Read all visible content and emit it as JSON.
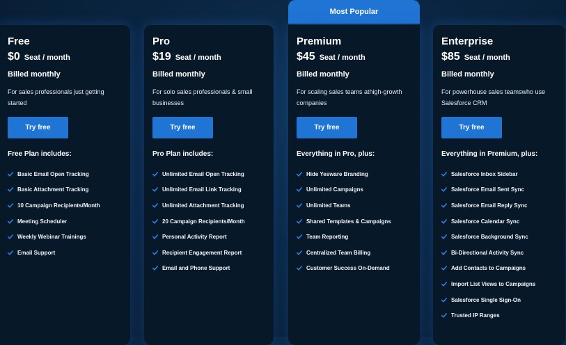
{
  "colors": {
    "accent": "#1f74d4",
    "card_bg": "#071829",
    "page_bg": "#0a2440",
    "check": "#2d7fdc"
  },
  "banner": {
    "label": "Most Popular"
  },
  "plans": [
    {
      "name": "Free",
      "price": "$0",
      "unit": "Seat / month",
      "billing": "Billed monthly",
      "description": "For sales professionals just getting started",
      "cta": "Try free",
      "includes_title": "Free Plan includes:",
      "features": [
        "Basic Email Open Tracking",
        "Basic Attachment Tracking",
        "10 Campaign Recipients/Month",
        "Meeting Scheduler",
        "Weekly Webinar Trainings",
        "Email Support"
      ]
    },
    {
      "name": "Pro",
      "price": "$19",
      "unit": "Seat / month",
      "billing": "Billed monthly",
      "description": "For solo sales professionals & small businesses",
      "cta": "Try free",
      "includes_title": "Pro Plan includes:",
      "features": [
        "Unlimited Email Open Tracking",
        "Unlimited Email Link Tracking",
        "Unlimited Attachment Tracking",
        "20 Campaign Recipients/Month",
        "Personal Activity Report",
        "Recipient Engagement Report",
        "Email and Phone Support"
      ]
    },
    {
      "name": "Premium",
      "price": "$45",
      "unit": "Seat / month",
      "billing": "Billed monthly",
      "description": "For scaling sales teams athigh-growth companies",
      "cta": "Try free",
      "includes_title": "Everything in Pro, plus:",
      "features": [
        "Hide Yesware Branding",
        "Unlimited Campaigns",
        "Unlimited Teams",
        "Shared Templates & Campaigns",
        "Team Reporting",
        "Centralized Team Billing",
        "Customer Success On-Demand"
      ]
    },
    {
      "name": "Enterprise",
      "price": "$85",
      "unit": "Seat / month",
      "billing": "Billed monthly",
      "description": "For powerhouse sales teamswho use Salesforce CRM",
      "cta": "Try free",
      "includes_title": "Everything in Premium, plus:",
      "features": [
        "Salesforce Inbox Sidebar",
        "Salesforce Email Sent Sync",
        "Salesforce Email Reply Sync",
        "Salesforce Calendar Sync",
        "Salesforce Background Sync",
        "Bi-Directional Activity Sync",
        "Add Contacts to Campaigns",
        "Import List Views to Campaigns",
        "Salesforce Single Sign-On",
        "Trusted IP Ranges"
      ]
    }
  ]
}
